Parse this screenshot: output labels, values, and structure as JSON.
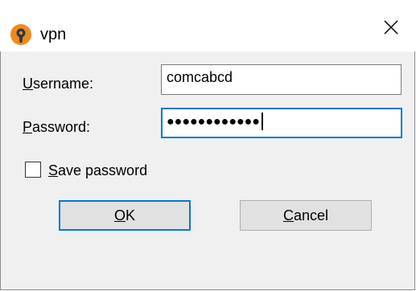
{
  "window": {
    "title": "vpn",
    "icon": "openvpn-logo-icon",
    "close_glyph": "✕"
  },
  "form": {
    "username": {
      "label_accel": "U",
      "label_rest": "sername:",
      "value": "comcabcd"
    },
    "password": {
      "label_accel": "P",
      "label_rest": "assword:",
      "masked_value": "●●●●●●●●●●●●"
    },
    "save_password": {
      "label_accel": "S",
      "label_rest": "ave password",
      "checked": false
    }
  },
  "buttons": {
    "ok": {
      "accel": "O",
      "rest": "K"
    },
    "cancel": {
      "accel": "C",
      "rest": "ancel"
    }
  },
  "colors": {
    "focus_accent": "#0078d7",
    "icon_orange": "#f08a1d",
    "icon_dark": "#2b3a4a"
  }
}
